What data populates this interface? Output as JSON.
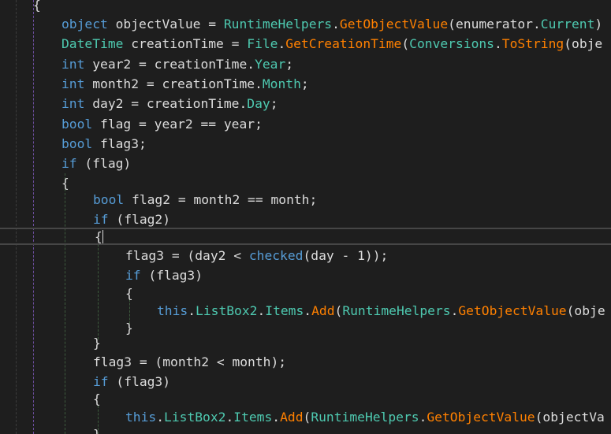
{
  "editor": {
    "lines": [
      {
        "tokens": [
          {
            "text": "{",
            "kind": "plain"
          }
        ]
      },
      {
        "tokens": [
          {
            "text": "object",
            "kind": "kw"
          },
          {
            "text": " objectValue = ",
            "kind": "plain"
          },
          {
            "text": "RuntimeHelpers",
            "kind": "type"
          },
          {
            "text": ".",
            "kind": "plain"
          },
          {
            "text": "GetObjectValue",
            "kind": "method"
          },
          {
            "text": "(enumerator.",
            "kind": "plain"
          },
          {
            "text": "Current",
            "kind": "prop"
          },
          {
            "text": ")",
            "kind": "plain"
          }
        ]
      },
      {
        "tokens": [
          {
            "text": "DateTime",
            "kind": "type"
          },
          {
            "text": " creationTime = ",
            "kind": "plain"
          },
          {
            "text": "File",
            "kind": "type"
          },
          {
            "text": ".",
            "kind": "plain"
          },
          {
            "text": "GetCreationTime",
            "kind": "method"
          },
          {
            "text": "(",
            "kind": "plain"
          },
          {
            "text": "Conversions",
            "kind": "type"
          },
          {
            "text": ".",
            "kind": "plain"
          },
          {
            "text": "ToString",
            "kind": "method"
          },
          {
            "text": "(obje",
            "kind": "plain"
          }
        ]
      },
      {
        "tokens": [
          {
            "text": "int",
            "kind": "kw"
          },
          {
            "text": " year2 = creationTime.",
            "kind": "plain"
          },
          {
            "text": "Year",
            "kind": "prop"
          },
          {
            "text": ";",
            "kind": "plain"
          }
        ]
      },
      {
        "tokens": [
          {
            "text": "int",
            "kind": "kw"
          },
          {
            "text": " month2 = creationTime.",
            "kind": "plain"
          },
          {
            "text": "Month",
            "kind": "prop"
          },
          {
            "text": ";",
            "kind": "plain"
          }
        ]
      },
      {
        "tokens": [
          {
            "text": "int",
            "kind": "kw"
          },
          {
            "text": " day2 = creationTime.",
            "kind": "plain"
          },
          {
            "text": "Day",
            "kind": "prop"
          },
          {
            "text": ";",
            "kind": "plain"
          }
        ]
      },
      {
        "tokens": [
          {
            "text": "bool",
            "kind": "kw"
          },
          {
            "text": " flag = year2 == year;",
            "kind": "plain"
          }
        ]
      },
      {
        "tokens": [
          {
            "text": "bool",
            "kind": "kw"
          },
          {
            "text": " flag3;",
            "kind": "plain"
          }
        ]
      },
      {
        "tokens": [
          {
            "text": "if",
            "kind": "kw"
          },
          {
            "text": " (flag)",
            "kind": "plain"
          }
        ]
      },
      {
        "tokens": [
          {
            "text": "{",
            "kind": "plain"
          }
        ]
      },
      {
        "tokens": [
          {
            "text": "bool",
            "kind": "kw"
          },
          {
            "text": " flag2 = month2 == month;",
            "kind": "plain"
          }
        ]
      },
      {
        "tokens": [
          {
            "text": "if",
            "kind": "kw"
          },
          {
            "text": " (flag2)",
            "kind": "plain"
          }
        ]
      },
      {
        "tokens": [
          {
            "text": "{",
            "kind": "plain"
          }
        ],
        "caret": true
      },
      {
        "tokens": [
          {
            "text": "flag3 = (day2 < ",
            "kind": "plain"
          },
          {
            "text": "checked",
            "kind": "kw"
          },
          {
            "text": "(day - 1));",
            "kind": "plain"
          }
        ]
      },
      {
        "tokens": [
          {
            "text": "if",
            "kind": "kw"
          },
          {
            "text": " (flag3)",
            "kind": "plain"
          }
        ]
      },
      {
        "tokens": [
          {
            "text": "{",
            "kind": "plain"
          }
        ]
      },
      {
        "tokens": [
          {
            "text": "this",
            "kind": "kw"
          },
          {
            "text": ".",
            "kind": "plain"
          },
          {
            "text": "ListBox2",
            "kind": "prop"
          },
          {
            "text": ".",
            "kind": "plain"
          },
          {
            "text": "Items",
            "kind": "prop"
          },
          {
            "text": ".",
            "kind": "plain"
          },
          {
            "text": "Add",
            "kind": "method"
          },
          {
            "text": "(",
            "kind": "plain"
          },
          {
            "text": "RuntimeHelpers",
            "kind": "type"
          },
          {
            "text": ".",
            "kind": "plain"
          },
          {
            "text": "GetObjectValue",
            "kind": "method"
          },
          {
            "text": "(obje",
            "kind": "plain"
          }
        ]
      },
      {
        "tokens": [
          {
            "text": "}",
            "kind": "plain"
          }
        ]
      },
      {
        "tokens": [
          {
            "text": "}",
            "kind": "plain"
          }
        ]
      },
      {
        "tokens": [
          {
            "text": "flag3 = (month2 < month);",
            "kind": "plain"
          }
        ]
      },
      {
        "tokens": [
          {
            "text": "if",
            "kind": "kw"
          },
          {
            "text": " (flag3)",
            "kind": "plain"
          }
        ]
      },
      {
        "tokens": [
          {
            "text": "{",
            "kind": "plain"
          }
        ]
      },
      {
        "tokens": [
          {
            "text": "this",
            "kind": "kw"
          },
          {
            "text": ".",
            "kind": "plain"
          },
          {
            "text": "ListBox2",
            "kind": "prop"
          },
          {
            "text": ".",
            "kind": "plain"
          },
          {
            "text": "Items",
            "kind": "prop"
          },
          {
            "text": ".",
            "kind": "plain"
          },
          {
            "text": "Add",
            "kind": "method"
          },
          {
            "text": "(",
            "kind": "plain"
          },
          {
            "text": "RuntimeHelpers",
            "kind": "type"
          },
          {
            "text": ".",
            "kind": "plain"
          },
          {
            "text": "GetObjectValue",
            "kind": "method"
          },
          {
            "text": "(objectVa",
            "kind": "plain"
          }
        ]
      },
      {
        "tokens": [
          {
            "text": "}",
            "kind": "plain"
          }
        ]
      }
    ]
  }
}
